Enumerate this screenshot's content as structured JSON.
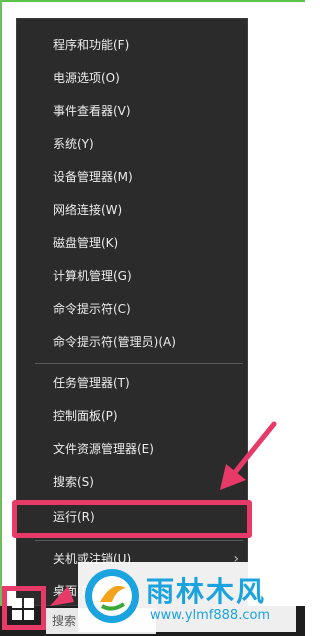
{
  "menu": {
    "items": [
      {
        "label": "程序和功能(F)"
      },
      {
        "label": "电源选项(O)"
      },
      {
        "label": "事件查看器(V)"
      },
      {
        "label": "系统(Y)"
      },
      {
        "label": "设备管理器(M)"
      },
      {
        "label": "网络连接(W)"
      },
      {
        "label": "磁盘管理(K)"
      },
      {
        "label": "计算机管理(G)"
      },
      {
        "label": "命令提示符(C)"
      },
      {
        "label": "命令提示符(管理员)(A)"
      }
    ],
    "items2": [
      {
        "label": "任务管理器(T)"
      },
      {
        "label": "控制面板(P)"
      },
      {
        "label": "文件资源管理器(E)"
      },
      {
        "label": "搜索(S)"
      },
      {
        "label": "运行(R)"
      }
    ],
    "items3": [
      {
        "label": "关机或注销(U)"
      },
      {
        "label": "桌面(D)"
      }
    ]
  },
  "taskbar": {
    "search_label": "搜索"
  },
  "watermark": {
    "title": "雨林木风",
    "url": "www.ylmf888.com"
  },
  "colors": {
    "menu_bg": "#2b2b2b",
    "highlight": "#e83a68",
    "brand": "#1aa3df"
  }
}
